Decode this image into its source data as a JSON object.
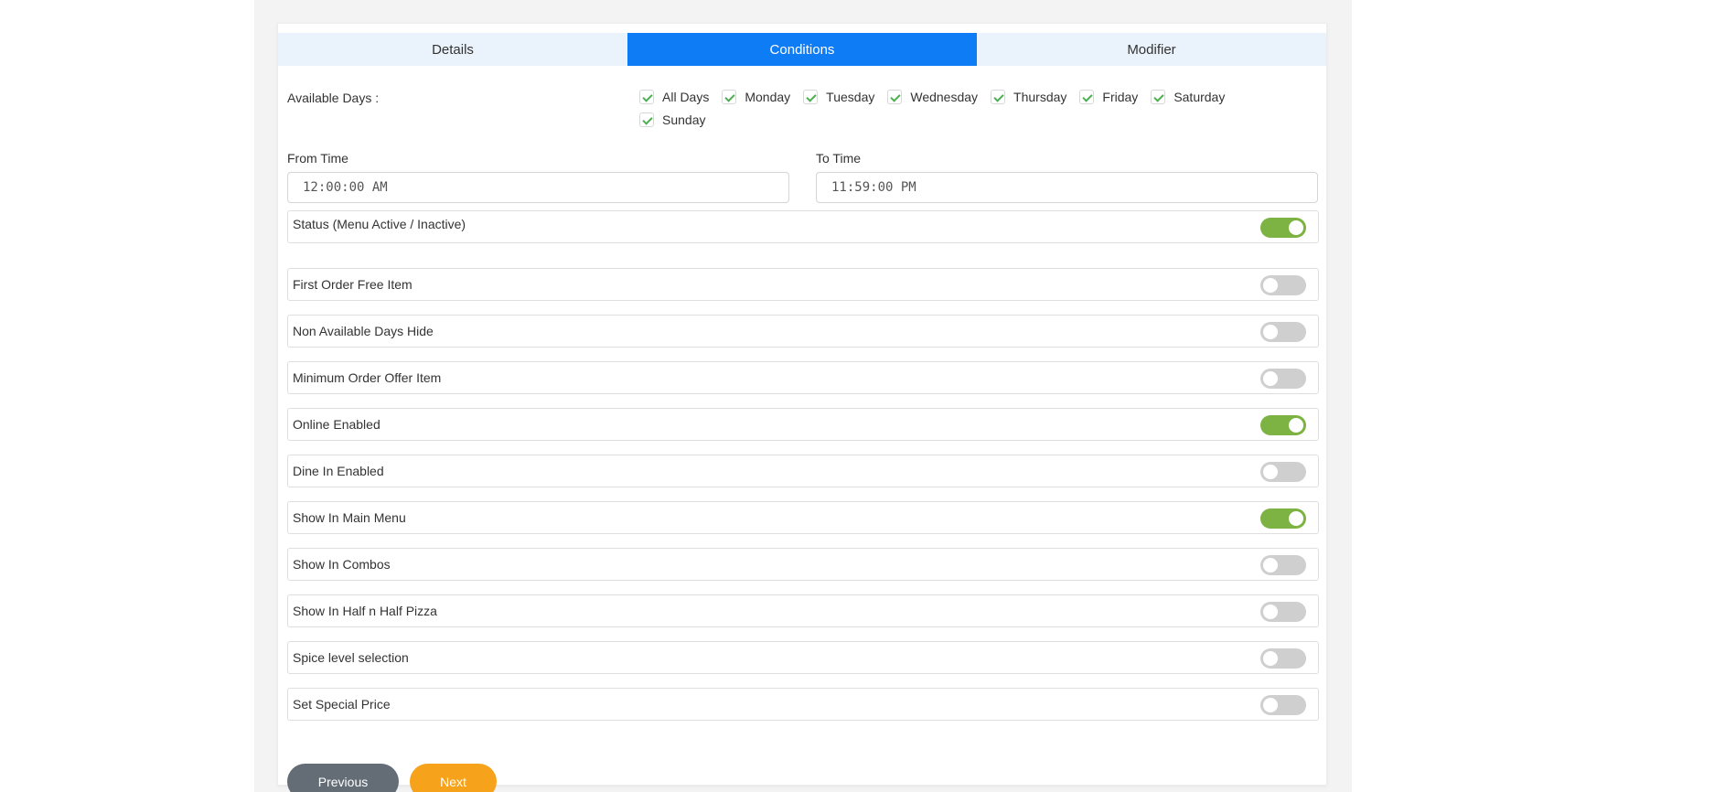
{
  "tabs": [
    {
      "label": "Details",
      "active": false
    },
    {
      "label": "Conditions",
      "active": true
    },
    {
      "label": "Modifier",
      "active": false
    }
  ],
  "available_days": {
    "label": "Available Days :",
    "options": [
      {
        "label": "All Days",
        "checked": true
      },
      {
        "label": "Monday",
        "checked": true
      },
      {
        "label": "Tuesday",
        "checked": true
      },
      {
        "label": "Wednesday",
        "checked": true
      },
      {
        "label": "Thursday",
        "checked": true
      },
      {
        "label": "Friday",
        "checked": true
      },
      {
        "label": "Saturday",
        "checked": true
      },
      {
        "label": "Sunday",
        "checked": true
      }
    ]
  },
  "from_time": {
    "label": "From Time",
    "value": "12:00:00 AM"
  },
  "to_time": {
    "label": "To Time",
    "value": "11:59:00 PM"
  },
  "toggles": [
    {
      "label": "Status (Menu Active / Inactive)",
      "on": true
    },
    {
      "label": "First Order Free Item",
      "on": false
    },
    {
      "label": "Non Available Days Hide",
      "on": false
    },
    {
      "label": "Minimum Order Offer Item",
      "on": false
    },
    {
      "label": "Online Enabled",
      "on": true
    },
    {
      "label": "Dine In Enabled",
      "on": false
    },
    {
      "label": "Show In Main Menu",
      "on": true
    },
    {
      "label": "Show In Combos",
      "on": false
    },
    {
      "label": "Show In Half n Half Pizza",
      "on": false
    },
    {
      "label": "Spice level selection",
      "on": false
    },
    {
      "label": "Set Special Price",
      "on": false
    }
  ],
  "buttons": {
    "previous": "Previous",
    "next": "Next"
  },
  "colors": {
    "tab_active": "#0d7cf5",
    "toggle_on": "#7cb342",
    "toggle_off": "#cfcfcf",
    "check": "#4caf50",
    "previous_button": "#646d76",
    "next_button": "#f7a21b"
  }
}
